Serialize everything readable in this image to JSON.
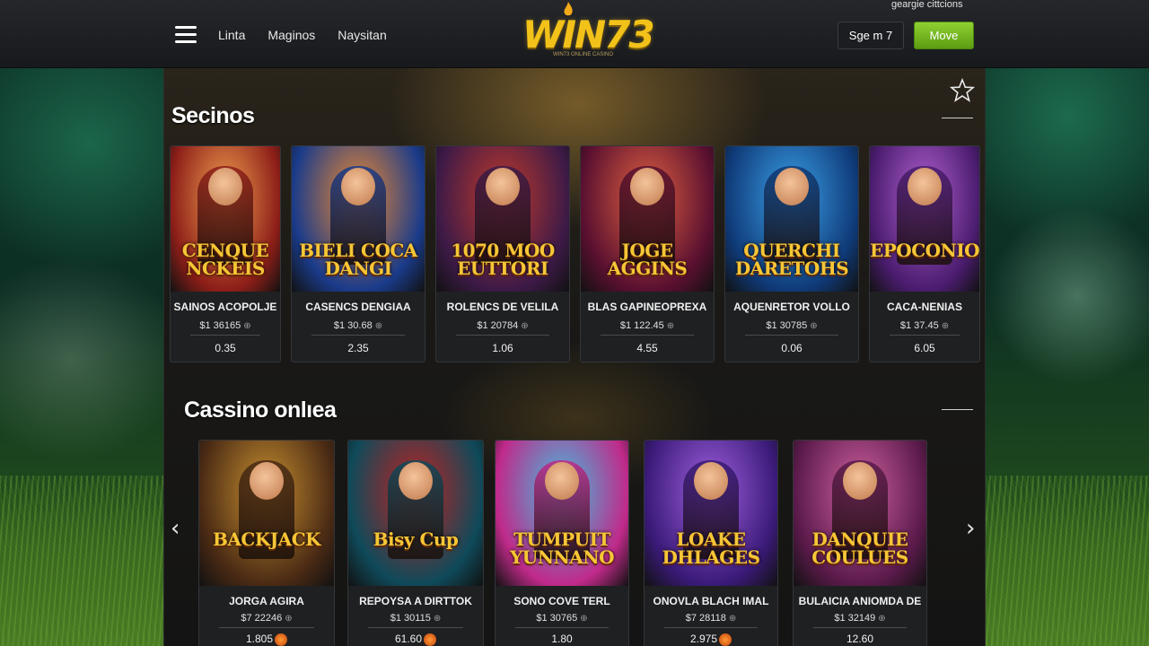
{
  "header": {
    "nav": [
      "Linta",
      "Maginos",
      "Naysitan"
    ],
    "logo": "WIN73",
    "logo_tagline": "WIN73 ONLINE CASINO",
    "top_right_text": "geargie cittcions",
    "signin_label": "Sge m 7",
    "move_label": "Move"
  },
  "section1": {
    "title": "Secinos",
    "games": [
      {
        "art_title": "CENQUE NCKEIS",
        "name": "SAINOS ACOPOLJE",
        "price": "$1 36165",
        "odds": "0.35",
        "theme": [
          "#8d1e18",
          "#f0a050"
        ]
      },
      {
        "art_title": "BIELI COCA DANGI",
        "name": "CASENCS DENGIAA",
        "price": "$1 30.68",
        "odds": "2.35",
        "theme": [
          "#1a3b8a",
          "#f08a30"
        ]
      },
      {
        "art_title": "1070 MOO EUTTORI",
        "name": "ROLENCS DE VELILA",
        "price": "$1 20784",
        "odds": "1.06",
        "theme": [
          "#3d1a47",
          "#c0392b"
        ]
      },
      {
        "art_title": "JOGE AGGINS",
        "name": "BLAS GAPINEOPREXA",
        "price": "$1 122.45",
        "odds": "4.55",
        "theme": [
          "#5a1030",
          "#e06040"
        ]
      },
      {
        "art_title": "QUERCHI DARETOHS",
        "name": "AQUENRETOR VOLLO",
        "price": "$1 30785",
        "odds": "0.06",
        "theme": [
          "#0f3a78",
          "#3aa0e8"
        ]
      },
      {
        "art_title": "EPOCONIO",
        "name": "CACA-NENIAS",
        "price": "$1 37.45",
        "odds": "6.05",
        "theme": [
          "#4a1c6e",
          "#b060d0"
        ]
      }
    ]
  },
  "section2": {
    "title": "Cassino onlıea",
    "games": [
      {
        "art_title": "BACKJACK",
        "name": "JORGA AGIRA",
        "price": "$7 22246",
        "odds": "1.805",
        "chip": true,
        "theme": [
          "#4a2a14",
          "#c89030"
        ]
      },
      {
        "art_title": "Bisy Cup",
        "name": "REPOYSA A DIRTTOK",
        "price": "$1 30115",
        "odds": "61.60",
        "chip": true,
        "theme": [
          "#0f4a5a",
          "#c02020"
        ]
      },
      {
        "art_title": "TUMPUIT YUNNANO",
        "name": "SONO COVE TERL",
        "price": "$1 30765",
        "odds": "1.80",
        "chip": false,
        "theme": [
          "#c02a8a",
          "#40c0e0"
        ]
      },
      {
        "art_title": "LOAKE DHLAGES",
        "name": "ONOVLA BLACH IMAL",
        "price": "$7 28118",
        "odds": "2.975",
        "chip": true,
        "theme": [
          "#3a1a78",
          "#a060e0"
        ]
      },
      {
        "art_title": "DANQUIE COULUES",
        "name": "BULAICIA ANIOMDA DE",
        "price": "$1 32149",
        "odds": "12.60",
        "chip": false,
        "theme": [
          "#5a1a4a",
          "#d060a0"
        ]
      }
    ]
  },
  "icons": {
    "menu": "hamburger-icon",
    "favorite": "star-icon",
    "prev": "chevron-left-icon",
    "next": "chevron-right-icon",
    "coin": "coin-icon",
    "chip": "chip-icon"
  },
  "colors": {
    "accent_green": "#7cc224",
    "logo_gold": "#f2c21a"
  }
}
